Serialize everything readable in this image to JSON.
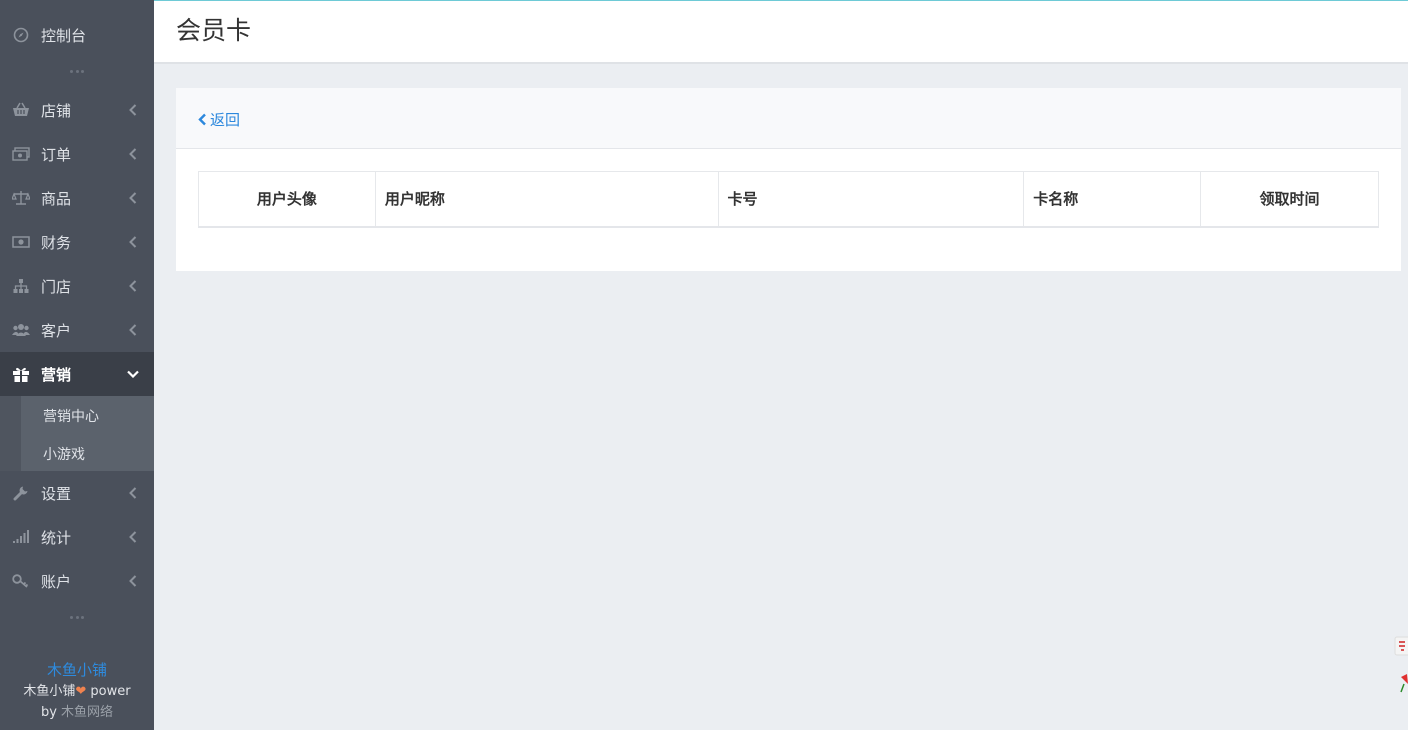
{
  "sidebar": {
    "items": [
      {
        "label": "控制台",
        "icon": "compass-icon"
      },
      {
        "label": "店铺",
        "icon": "basket-icon"
      },
      {
        "label": "订单",
        "icon": "money-icon"
      },
      {
        "label": "商品",
        "icon": "scale-icon"
      },
      {
        "label": "财务",
        "icon": "cash-icon"
      },
      {
        "label": "门店",
        "icon": "sitemap-icon"
      },
      {
        "label": "客户",
        "icon": "users-icon"
      },
      {
        "label": "营销",
        "icon": "gift-icon"
      },
      {
        "label": "设置",
        "icon": "wrench-icon"
      },
      {
        "label": "统计",
        "icon": "signal-icon"
      },
      {
        "label": "账户",
        "icon": "key-icon"
      }
    ],
    "submenu": [
      {
        "label": "营销中心"
      },
      {
        "label": "小游戏"
      }
    ],
    "footer": {
      "brand": "木鱼小铺",
      "line_prefix": "木鱼小铺",
      "line_suffix": " power",
      "by": "by",
      "company": "木鱼网络"
    }
  },
  "header": {
    "title": "会员卡"
  },
  "card": {
    "back_label": "返回",
    "table": {
      "columns": [
        "用户头像",
        "用户昵称",
        "卡号",
        "卡名称",
        "领取时间"
      ]
    }
  },
  "colors": {
    "sidebar_bg": "#4a505b",
    "active_bg": "#3a3f48",
    "accent": "#2c88dd",
    "page_bg": "#ebeef2"
  }
}
